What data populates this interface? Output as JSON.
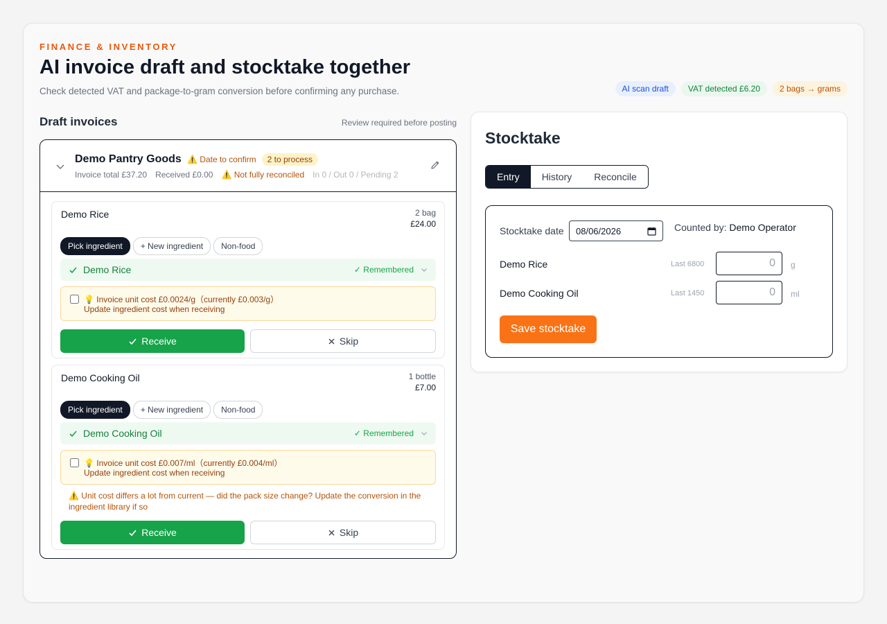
{
  "header": {
    "kicker": "FINANCE & INVENTORY",
    "title": "AI invoice draft and stocktake together",
    "subtitle": "Check detected VAT and package-to-gram conversion before confirming any purchase.",
    "pills": [
      "AI scan draft",
      "VAT detected £6.20",
      "2 bags → grams"
    ]
  },
  "drafts": {
    "title": "Draft invoices",
    "note": "Review required before posting",
    "invoice": {
      "supplier": "Demo Pantry Goods",
      "date_warning": "⚠️ Date to confirm",
      "to_process": "2 to process",
      "total": "Invoice total £37.20",
      "received": "Received £0.00",
      "reconcile_warning": "⚠️ Not fully reconciled",
      "counts": "In 0 / Out 0 / Pending 2"
    },
    "items": [
      {
        "name": "Demo Rice",
        "qty": "2 bag",
        "price": "£24.00",
        "chips": [
          "Pick ingredient",
          "+ New ingredient",
          "Non-food"
        ],
        "matched": "Demo Rice",
        "remembered": "✓ Remembered",
        "tip_line1": "💡 Invoice unit cost £0.0024/g（currently £0.003/g）",
        "tip_line2": "Update ingredient cost when receiving",
        "warning": "",
        "receive": "Receive",
        "skip": "Skip"
      },
      {
        "name": "Demo Cooking Oil",
        "qty": "1 bottle",
        "price": "£7.00",
        "chips": [
          "Pick ingredient",
          "+ New ingredient",
          "Non-food"
        ],
        "matched": "Demo Cooking Oil",
        "remembered": "✓ Remembered",
        "tip_line1": "💡 Invoice unit cost £0.007/ml（currently £0.004/ml）",
        "tip_line2": "Update ingredient cost when receiving",
        "warning": "⚠️ Unit cost differs a lot from current — did the pack size change? Update the conversion in the ingredient library if so",
        "receive": "Receive",
        "skip": "Skip"
      }
    ]
  },
  "stocktake": {
    "title": "Stocktake",
    "tabs": [
      "Entry",
      "History",
      "Reconcile"
    ],
    "date_label": "Stocktake date",
    "date_value": "08/06/2026",
    "counted_label": "Counted by:",
    "counted_value": "Demo Operator",
    "rows": [
      {
        "name": "Demo Rice",
        "last": "Last 6800",
        "value": "0",
        "unit": "g"
      },
      {
        "name": "Demo Cooking Oil",
        "last": "Last 1450",
        "value": "0",
        "unit": "ml"
      }
    ],
    "save": "Save stocktake"
  },
  "colors": {
    "accent": "#ea580c",
    "receive": "#16a34a",
    "save": "#f97316",
    "dark": "#111827"
  }
}
